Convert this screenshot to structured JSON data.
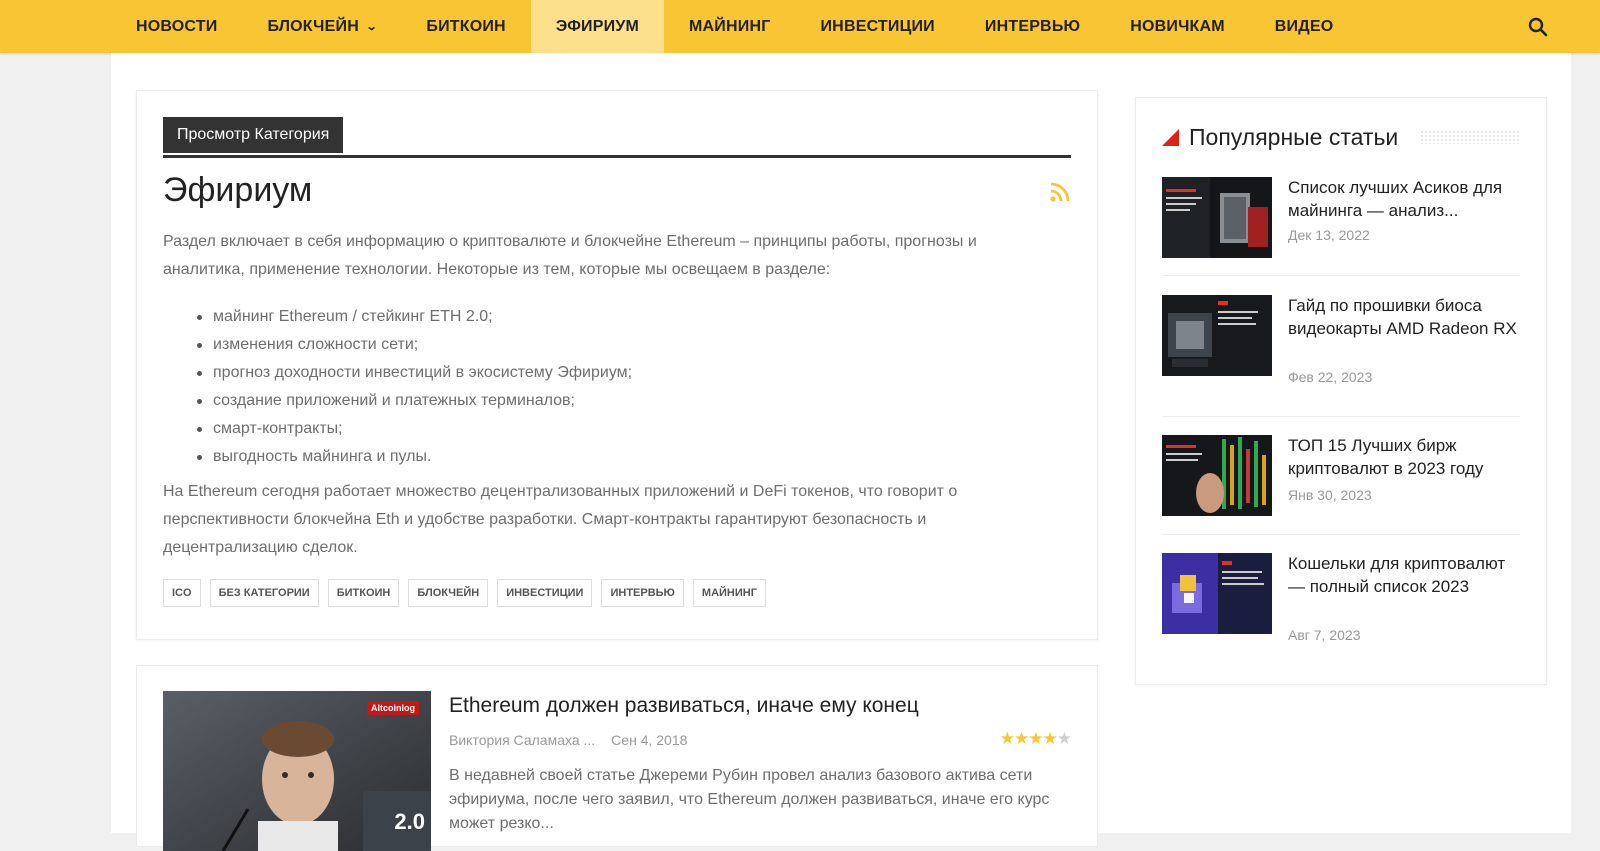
{
  "nav": {
    "items": [
      {
        "label": "НОВОСТИ",
        "active": false
      },
      {
        "label": "БЛОКЧЕЙН",
        "active": false,
        "has_dropdown": true
      },
      {
        "label": "БИТКОИН",
        "active": false
      },
      {
        "label": "ЭФИРИУМ",
        "active": true
      },
      {
        "label": "МАЙНИНГ",
        "active": false
      },
      {
        "label": "ИНВЕСТИЦИИ",
        "active": false
      },
      {
        "label": "ИНТЕРВЬЮ",
        "active": false
      },
      {
        "label": "НОВИЧКАМ",
        "active": false
      },
      {
        "label": "ВИДЕО",
        "active": false
      }
    ],
    "search_icon": "search-icon",
    "bg_color": "#f8c535",
    "active_bg_color": "#fde08b"
  },
  "category": {
    "header_label": "Просмотр Категория",
    "title": "Эфириум",
    "description": "Раздел включает в себя информацию о криптовалюте и блокчейне Ethereum – принципы работы, прогнозы и аналитика, применение технологии. Некоторые из тем, которые мы освещаем в разделе:",
    "bullets": [
      "майнинг Ethereum / стейкинг ETH 2.0;",
      "изменения сложности сети;",
      "прогноз доходности инвестиций в экосистему Эфириум;",
      "создание приложений и платежных терминалов;",
      "смарт-контракты;",
      "выгодность майнинга и пулы."
    ],
    "description2": "На Ethereum сегодня работает множество децентрализованных приложений и DeFi токенов, что говорит о перспективности блокчейна Eth и удобстве разработки. Смарт-контракты гарантируют безопасность и децентрализацию сделок.",
    "tags": [
      "ICO",
      "БЕЗ КАТЕГОРИИ",
      "БИТКОИН",
      "БЛОКЧЕЙН",
      "ИНВЕСТИЦИИ",
      "ИНТЕРВЬЮ",
      "МАЙНИНГ"
    ],
    "rss_icon": "rss-icon",
    "rss_color": "#f8c535"
  },
  "article": {
    "title": "Ethereum должен развиваться, иначе ему конец",
    "author": "Виктория Саламаха ...",
    "date": "Сен 4, 2018",
    "rating": 4,
    "rating_max": 5,
    "excerpt": "В недавней своей статье Джереми Рубин провел анализ базового актива сети эфириума, после чего заявил, что Ethereum должен развиваться, иначе его курс может резко...",
    "thumb_badge": "Altcoinlog",
    "thumb_overlay": "2.0"
  },
  "sidebar": {
    "title": "Популярные статьи",
    "accent_color": "#e0201b",
    "items": [
      {
        "title": "Список лучших Асиков для майнинга — анализ...",
        "date": "Дек 13, 2022"
      },
      {
        "title": "Гайд по прошивки биоса видеокарты AMD Radeon RX",
        "date": "Фев 22, 2023"
      },
      {
        "title": "ТОП 15 Лучших бирж криптовалют в 2023 году",
        "date": "Янв 30, 2023"
      },
      {
        "title": "Кошельки для криптовалют — полный список 2023",
        "date": "Авг 7, 2023"
      }
    ]
  }
}
